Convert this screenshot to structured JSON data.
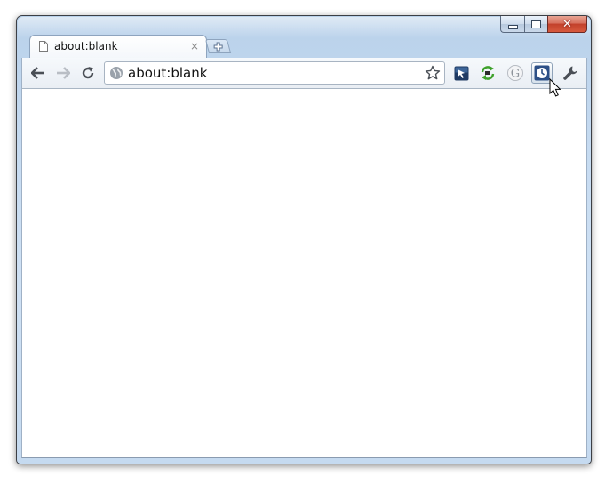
{
  "tab": {
    "title": "about:blank",
    "close_glyph": "×"
  },
  "new_tab": {
    "glyph": "+"
  },
  "window_controls": {
    "minimize": "minimize-icon",
    "maximize": "maximize-icon",
    "close": "✕"
  },
  "toolbar": {
    "back": "back-arrow-icon",
    "forward": "forward-arrow-icon",
    "reload": "reload-icon",
    "omnibox": {
      "url": "about:blank",
      "page_icon": "globe-icon",
      "bookmark": "star-icon"
    },
    "extensions": [
      "pointer-extension-icon",
      "sync-extension-icon",
      "google-extension-icon",
      "clock-extension-icon"
    ],
    "menu": "wrench-icon"
  },
  "colors": {
    "accent": "#2c4f86",
    "extension_green": "#3ea12b",
    "frame": "#c6dbf1"
  }
}
